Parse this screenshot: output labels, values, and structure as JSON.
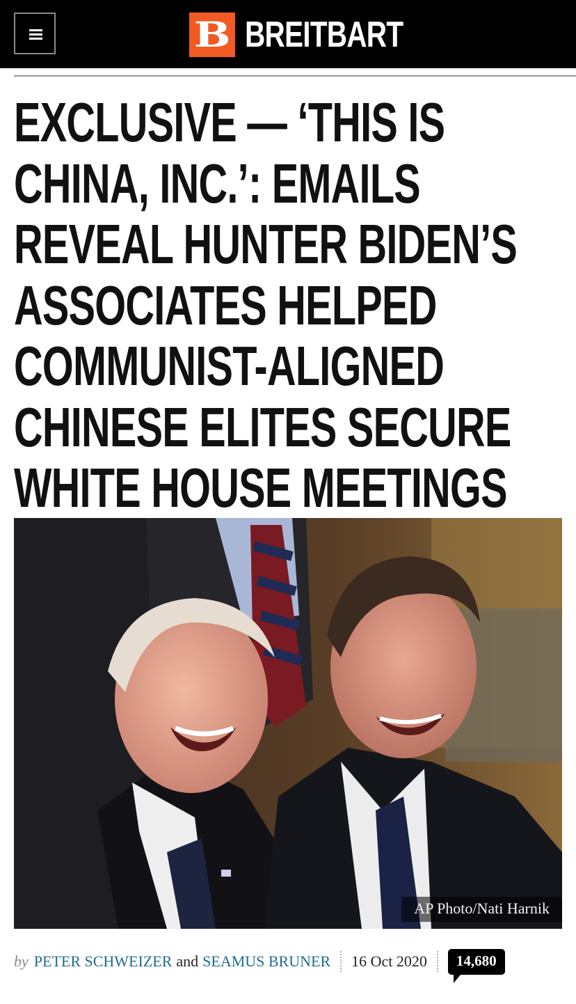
{
  "header": {
    "menu_icon": "hamburger-menu-icon",
    "logo_mark": "B",
    "logo_text": "BREITBART",
    "brand_color": "#f15a22",
    "background_color": "#000000"
  },
  "article": {
    "headline_lines": [
      "EXCLUSIVE — ‘THIS IS",
      "CHINA, INC.’: EMAILS",
      "REVEAL HUNTER BIDEN’S",
      "ASSOCIATES HELPED",
      "COMMUNIST-ALIGNED",
      "CHINESE ELITES SECURE",
      "WHITE HOUSE MEETINGS"
    ],
    "photo_caption": "AP Photo/Nati Harnik",
    "byline": {
      "by": "by",
      "author1": "PETER SCHWEIZER",
      "and": "and",
      "author2": "SEAMUS BRUNER",
      "date": "16 Oct 2020",
      "comment_count": "14,680"
    },
    "link_color": "#1f6b8f"
  }
}
